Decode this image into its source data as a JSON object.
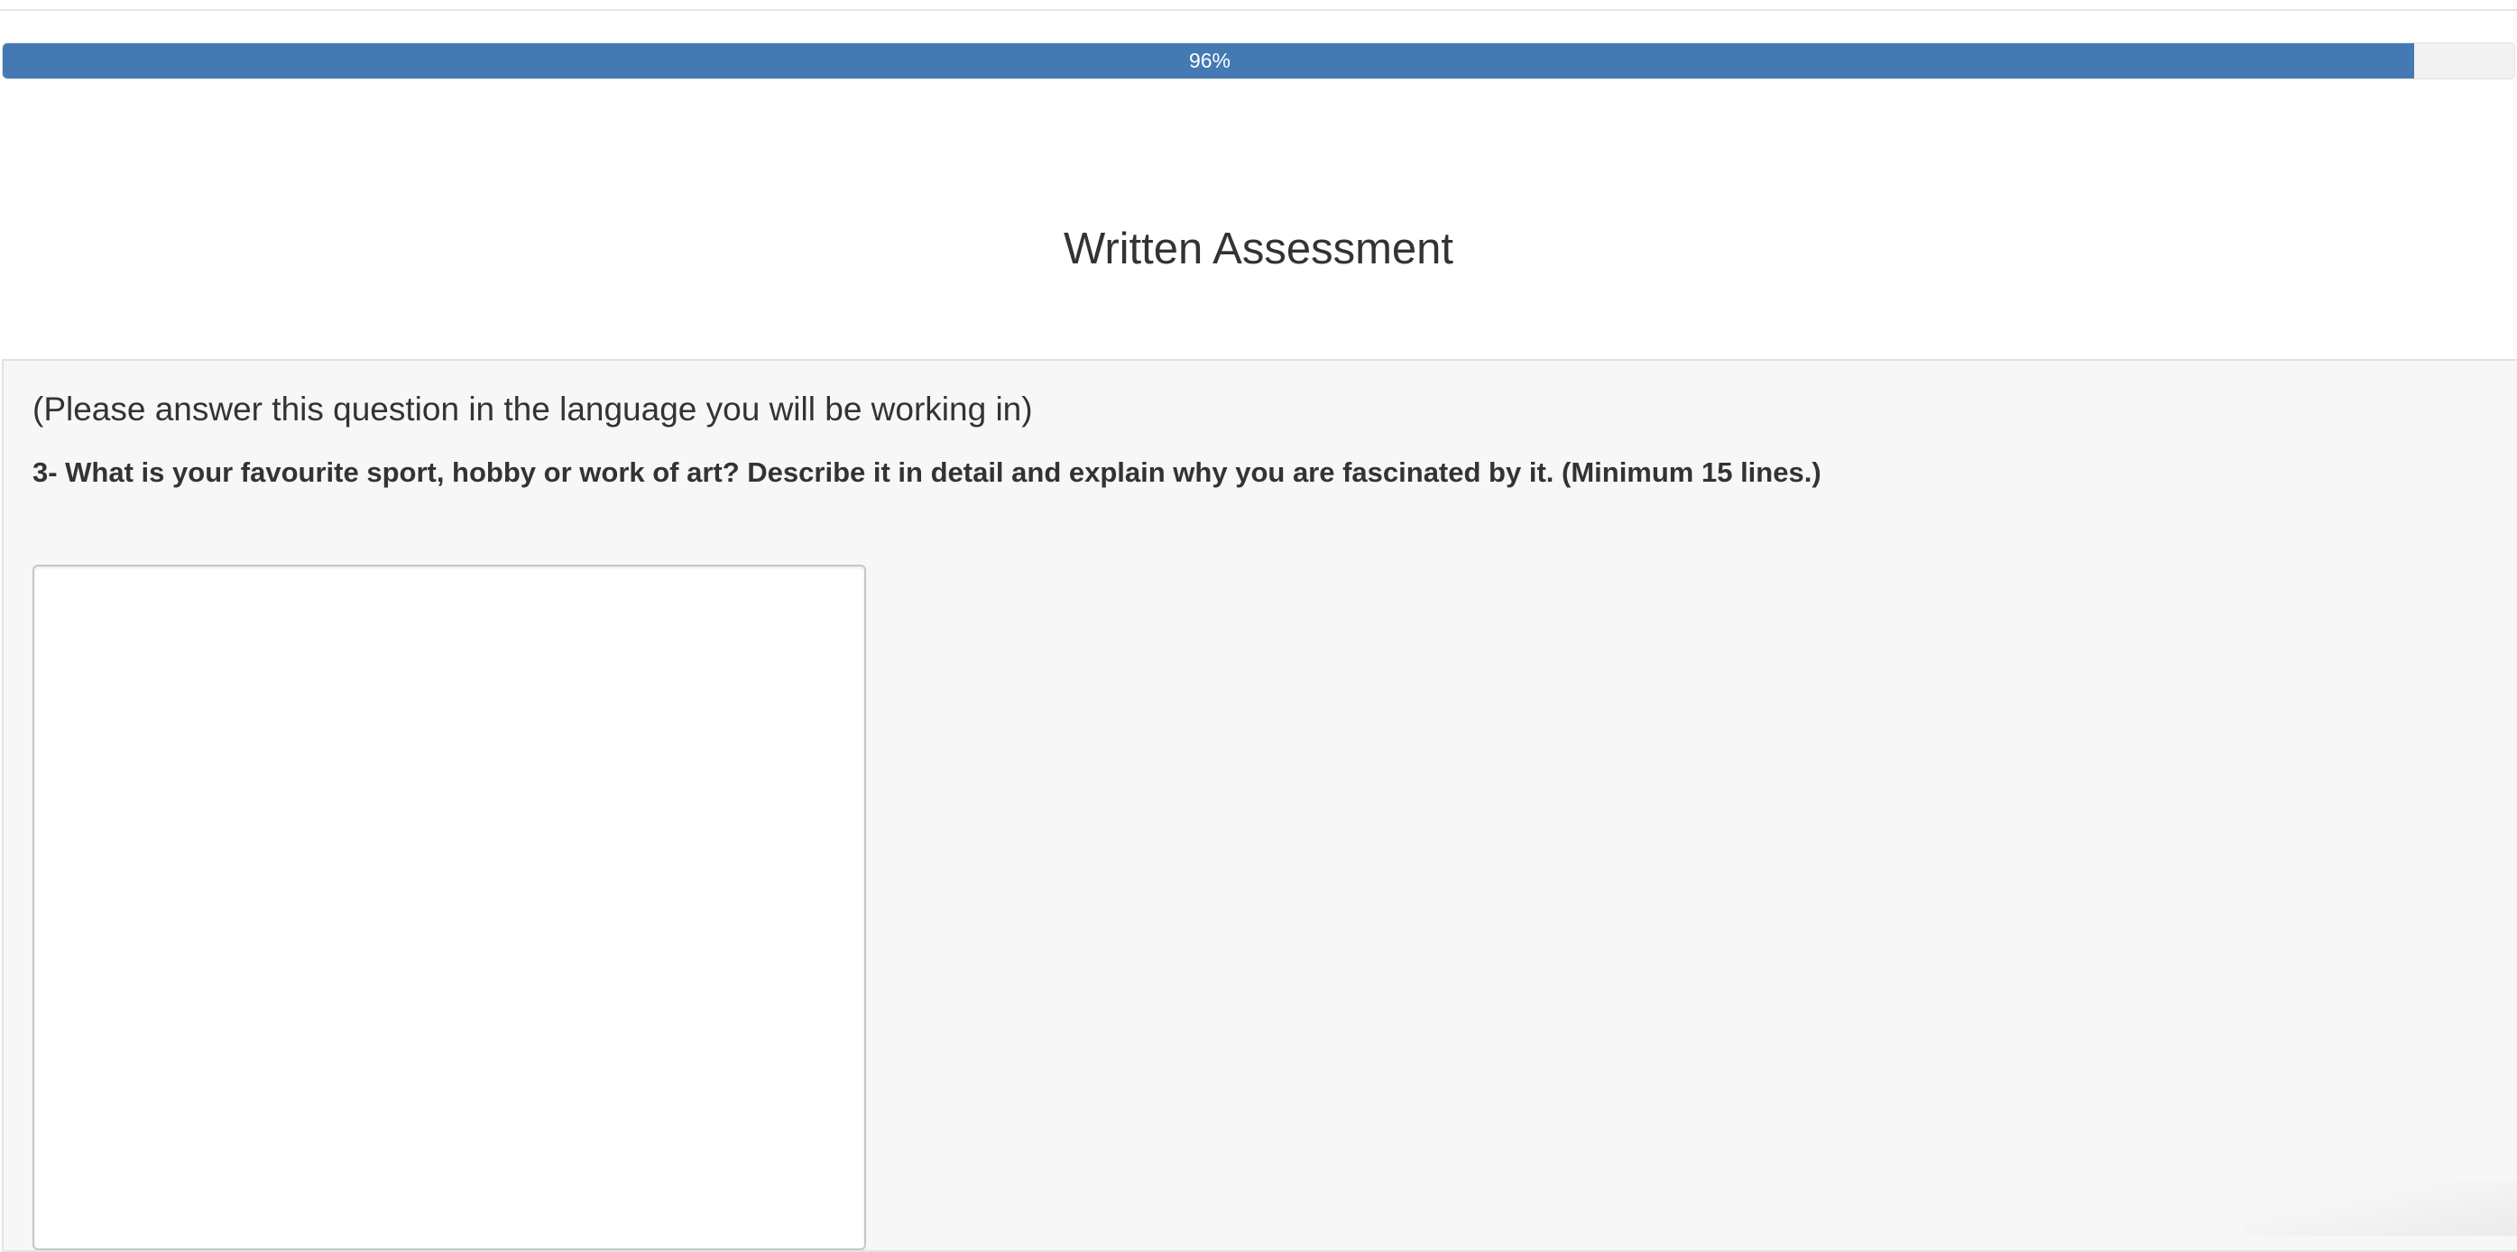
{
  "progress": {
    "percent": 96,
    "label": "96%",
    "color": "#4479b3"
  },
  "page": {
    "title": "Written Assessment"
  },
  "question": {
    "instructions": "(Please answer this question in the language you will be working in)",
    "text": "3- What is your favourite sport, hobby or work of art? Describe it in detail and explain why you are fascinated by it. (Minimum 15 lines.)",
    "answer_value": ""
  }
}
